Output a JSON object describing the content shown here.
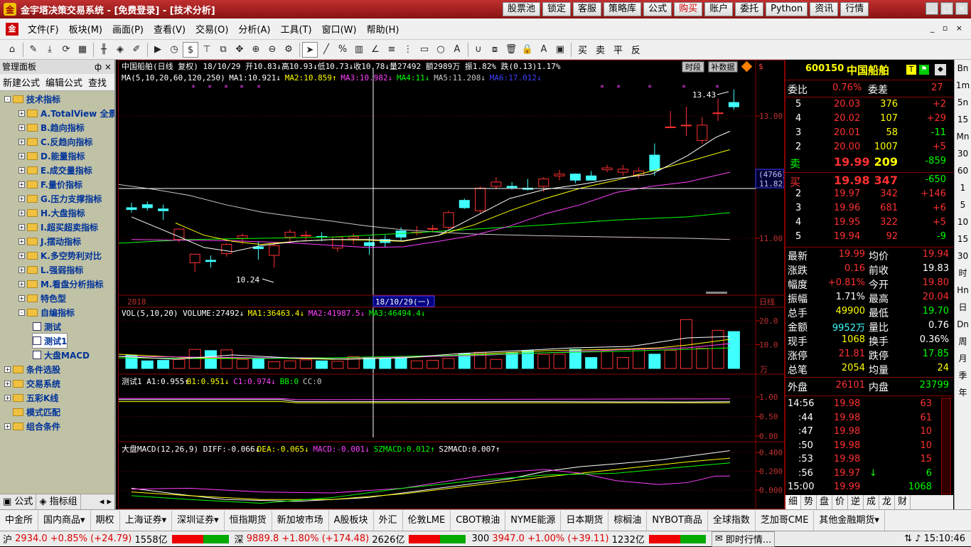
{
  "title": "金宇塔决策交易系统 - [免费登录] - [技术分析]",
  "top_buttons": [
    "股票池",
    "锁定",
    "客服",
    "策略库",
    "公式",
    "购买",
    "账户",
    "委托",
    "Python",
    "资讯",
    "行情"
  ],
  "menu": [
    "文件(F)",
    "板块(M)",
    "画面(P)",
    "查看(V)",
    "交易(O)",
    "分析(A)",
    "工具(T)",
    "窗口(W)",
    "帮助(H)"
  ],
  "toolbar_text": [
    "买",
    "卖",
    "平",
    "反"
  ],
  "left": {
    "header": "管理面板",
    "pin": "ф ×",
    "tabs": [
      "新建公式",
      "编辑公式",
      "查找"
    ],
    "tree": [
      {
        "label": "技术指标",
        "lvl": 0,
        "exp": "-"
      },
      {
        "label": "A.TotalView 全景",
        "lvl": 1,
        "exp": "+"
      },
      {
        "label": "B.趋向指标",
        "lvl": 1,
        "exp": "+"
      },
      {
        "label": "C.反趋向指标",
        "lvl": 1,
        "exp": "+"
      },
      {
        "label": "D.能量指标",
        "lvl": 1,
        "exp": "+"
      },
      {
        "label": "E.成交量指标",
        "lvl": 1,
        "exp": "+"
      },
      {
        "label": "F.量价指标",
        "lvl": 1,
        "exp": "+"
      },
      {
        "label": "G.压力支撑指标",
        "lvl": 1,
        "exp": "+"
      },
      {
        "label": "H.大盘指标",
        "lvl": 1,
        "exp": "+"
      },
      {
        "label": "I.超买超卖指标",
        "lvl": 1,
        "exp": "+"
      },
      {
        "label": "J.摆动指标",
        "lvl": 1,
        "exp": "+"
      },
      {
        "label": "K.多空势利对比",
        "lvl": 1,
        "exp": "+"
      },
      {
        "label": "L.强弱指标",
        "lvl": 1,
        "exp": "+"
      },
      {
        "label": "M.看盘分析指标",
        "lvl": 1,
        "exp": "+"
      },
      {
        "label": "特色型",
        "lvl": 1,
        "exp": "+"
      },
      {
        "label": "自编指标",
        "lvl": 1,
        "exp": "-"
      },
      {
        "label": "测试",
        "lvl": 2,
        "exp": ""
      },
      {
        "label": "测试1",
        "lvl": 2,
        "exp": "",
        "sel": true
      },
      {
        "label": "大盘MACD",
        "lvl": 2,
        "exp": ""
      },
      {
        "label": "条件选股",
        "lvl": 0,
        "exp": "+"
      },
      {
        "label": "交易系统",
        "lvl": 0,
        "exp": "+"
      },
      {
        "label": "五彩K线",
        "lvl": 0,
        "exp": "+"
      },
      {
        "label": "模式匹配",
        "lvl": 0,
        "exp": ""
      },
      {
        "label": "组合条件",
        "lvl": 0,
        "exp": "+"
      }
    ],
    "bottom": [
      "公式",
      "指标组"
    ]
  },
  "chart": {
    "header": "中国船舶(日线 复权) 18/10/29 开10.83↓高10.93↓低10.73↓收10.78↓量27492 额2989万 振1.82% 跌(0.13)1.17%",
    "ma_labels": [
      {
        "t": "MA(5,10,20,60,120,250)",
        "c": "#ffffff"
      },
      {
        "t": "MA1:10.921↓",
        "c": "#ffffff"
      },
      {
        "t": "MA2:10.859↑",
        "c": "#ffff00"
      },
      {
        "t": "MA3:10.982↓",
        "c": "#ff40ff"
      },
      {
        "t": "MA4:11↓",
        "c": "#00ff00"
      },
      {
        "t": "MA5:11.208↓",
        "c": "#c8c8c8"
      },
      {
        "t": "MA6:17.012↓",
        "c": "#4040ff"
      }
    ],
    "btn_time": "时段",
    "btn_supp": "补数据",
    "price_ticks": [
      "13.00",
      "11.00"
    ],
    "cursor_price": "11.82",
    "cursor_vol": "(4766)",
    "hi_label": "13.43",
    "lo_label": "10.24",
    "year_label": "2018",
    "date_label": "18/10/29(一)",
    "period_label": "日线",
    "vol_header": [
      {
        "t": "VOL(5,10,20) VOLUME:27492↓",
        "c": "#ffffff"
      },
      {
        "t": "MA1:36463.4↓",
        "c": "#ffff00"
      },
      {
        "t": "MA2:41987.5↓",
        "c": "#ff40ff"
      },
      {
        "t": "MA3:46494.4↓",
        "c": "#00ff00"
      }
    ],
    "vol_ticks": [
      "20.0",
      "10.0"
    ],
    "vol_unit": "万",
    "ind_header": [
      {
        "t": "测试1 A1:0.955↑",
        "c": "#ffffff"
      },
      {
        "t": "B1:0.951↓",
        "c": "#ffff00"
      },
      {
        "t": "C1:0.974↓",
        "c": "#ff40ff"
      },
      {
        "t": "BB:0",
        "c": "#00ff00"
      },
      {
        "t": "CC:0",
        "c": "#c8c8c8"
      }
    ],
    "ind_ticks": [
      "1.00",
      "0.50",
      "0.00"
    ],
    "macd_header": [
      {
        "t": "大盘MACD(12,26,9) DIFF:-0.066↓",
        "c": "#ffffff"
      },
      {
        "t": "DEA:-0.065↓",
        "c": "#ffff00"
      },
      {
        "t": "MACD:-0.001↓",
        "c": "#ff40ff"
      },
      {
        "t": "SZMACD:0.012↑",
        "c": "#00ff00"
      },
      {
        "t": "S2MACD:0.007↑",
        "c": "#ffffff"
      }
    ],
    "macd_ticks": [
      "0.400",
      "0.200",
      "0.000"
    ]
  },
  "quote": {
    "code": "600150",
    "name": "中国船舶",
    "wb_label": "委比",
    "wb_val": "0.76%",
    "wc_label": "委差",
    "wc_val": "27",
    "sells": [
      {
        "lv": "5",
        "p": "20.03",
        "v": "376",
        "d": "+2"
      },
      {
        "lv": "4",
        "p": "20.02",
        "v": "107",
        "d": "+29"
      },
      {
        "lv": "3",
        "p": "20.01",
        "v": "58",
        "d": "-11"
      },
      {
        "lv": "2",
        "p": "20.00",
        "v": "1007",
        "d": "+5"
      },
      {
        "lv": "卖",
        "p": "19.99",
        "v": "209",
        "d": "-859"
      }
    ],
    "buys": [
      {
        "lv": "买",
        "p": "19.98",
        "v": "347",
        "d": "-650"
      },
      {
        "lv": "2",
        "p": "19.97",
        "v": "342",
        "d": "+146"
      },
      {
        "lv": "3",
        "p": "19.96",
        "v": "681",
        "d": "+6"
      },
      {
        "lv": "4",
        "p": "19.95",
        "v": "322",
        "d": "+5"
      },
      {
        "lv": "5",
        "p": "19.94",
        "v": "92",
        "d": "-9"
      }
    ],
    "stats": [
      {
        "a": "最新",
        "av": "19.99",
        "ac": "#ff3030",
        "b": "均价",
        "bv": "19.94",
        "bc": "#ff3030"
      },
      {
        "a": "涨跌",
        "av": "0.16",
        "ac": "#ff3030",
        "b": "前收",
        "bv": "19.83",
        "bc": "#ffffff"
      },
      {
        "a": "幅度",
        "av": "+0.81%",
        "ac": "#ff3030",
        "b": "今开",
        "bv": "19.80",
        "bc": "#ff3030"
      },
      {
        "a": "振幅",
        "av": "1.71%",
        "ac": "#ffffff",
        "b": "最高",
        "bv": "20.04",
        "bc": "#ff3030"
      },
      {
        "a": "总手",
        "av": "49900",
        "ac": "#ffff00",
        "b": "最低",
        "bv": "19.70",
        "bc": "#00ff00"
      },
      {
        "a": "金额",
        "av": "9952万",
        "ac": "#40ffff",
        "b": "量比",
        "bv": "0.76",
        "bc": "#ffffff"
      },
      {
        "a": "现手",
        "av": "1068",
        "ac": "#ffff00",
        "b": "换手",
        "bv": "0.36%",
        "bc": "#ffffff"
      },
      {
        "a": "涨停",
        "av": "21.81",
        "ac": "#ff3030",
        "b": "跌停",
        "bv": "17.85",
        "bc": "#00ff00"
      },
      {
        "a": "总笔",
        "av": "2054",
        "ac": "#ffff00",
        "b": "均量",
        "bv": "24",
        "bc": "#ffff00"
      }
    ],
    "outer": "外盘",
    "outer_v": "26101",
    "inner": "内盘",
    "inner_v": "23799",
    "ticks": [
      {
        "t": "14:56",
        "p": "19.98",
        "v": "63",
        "arrow": ""
      },
      {
        "t": ":44",
        "p": "19.98",
        "v": "61",
        "arrow": ""
      },
      {
        "t": ":47",
        "p": "19.98",
        "v": "10",
        "arrow": ""
      },
      {
        "t": ":50",
        "p": "19.98",
        "v": "10",
        "arrow": ""
      },
      {
        "t": ":53",
        "p": "19.98",
        "v": "15",
        "arrow": ""
      },
      {
        "t": ":56",
        "p": "19.97",
        "v": "6",
        "arrow": "↓"
      },
      {
        "t": "15:00",
        "p": "19.99",
        "v": "1068",
        "arrow": ""
      }
    ],
    "bottom_tabs": [
      "细",
      "势",
      "盘",
      "价",
      "逆",
      "成",
      "龙",
      "财"
    ]
  },
  "rcol": [
    "Bn",
    "1m",
    "5n",
    "15",
    "Mn",
    "30",
    "60",
    "1",
    "5",
    "10",
    "15",
    "30",
    "时",
    "Hn",
    "日",
    "Dn",
    "周",
    "月",
    "季",
    "年"
  ],
  "bottom_tabs": [
    "中金所",
    "国内商品▾",
    "期权",
    "上海证券▾",
    "深圳证券▾",
    "恒指期货",
    "新加坡市场",
    "A股板块",
    "外汇",
    "伦敦LME",
    "CBOT粮油",
    "NYME能源",
    "日本期货",
    "棕榈油",
    "NYBOT商品",
    "全球指数",
    "芝加哥CME",
    "其他金融期货▾"
  ],
  "status": {
    "sh": "沪",
    "sh_v": "2934.0 +0.85% (+24.79)",
    "sh_amt": "1558亿",
    "sz": "深",
    "sz_v": "9889.8 +1.80% (+174.48)",
    "sz_amt": "2626亿",
    "hs": "300",
    "hs_v": "3947.0 +1.00% (+39.11)",
    "hs_amt": "1232亿",
    "news": "即时行情...",
    "time": "15:10:46"
  },
  "colors": {
    "up": "#ff3030",
    "down": "#40ffff",
    "grid": "#800000",
    "bg": "#000000"
  }
}
